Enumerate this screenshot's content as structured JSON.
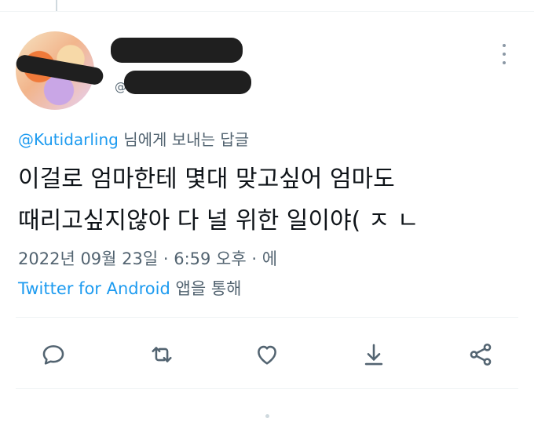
{
  "tweet": {
    "reply_to_handle": "@Kutidarling",
    "reply_to_suffix": "님에게 보내는 답글",
    "text_line1": "이걸로 엄마한테 몇대 맞고싶어 엄마도",
    "text_line2": "때리고싶지않아 다 널 위한 일이야( ㅈ ㄴ",
    "timestamp": "2022년 09월 23일 · 6:59 오후 · 에",
    "source_app": "Twitter for Android",
    "source_suffix": "앱을 통해"
  },
  "author": {
    "handle_prefix": "@"
  },
  "actions": [
    "reply-icon",
    "retweet-icon",
    "like-icon",
    "download-icon",
    "share-icon"
  ],
  "colors": {
    "link": "#1d9bf0",
    "muted": "#536471",
    "text": "#0f1419",
    "divider": "#eff3f4"
  }
}
